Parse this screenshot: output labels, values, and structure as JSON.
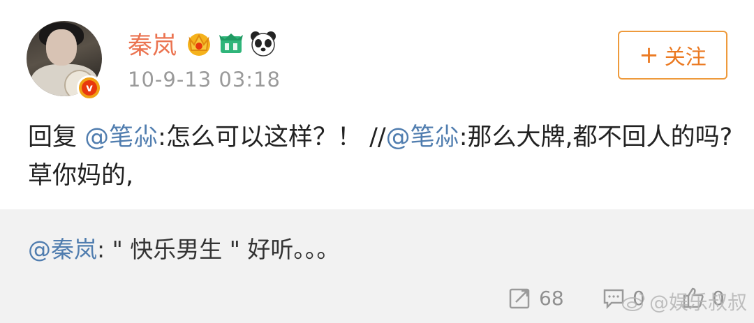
{
  "post": {
    "username": "秦岚",
    "timestamp": "10-9-13 03:18",
    "follow_label": "关注",
    "follow_plus": "+",
    "badges": [
      "crown-badge-icon",
      "green-member-badge-icon",
      "panda-badge-icon"
    ],
    "verified_glyph": "v",
    "content": {
      "prefix": "回复 ",
      "mention1": "@笔尛",
      "text1": ":怎么可以这样？！  //",
      "mention2": "@笔尛",
      "text2": ":那么大牌,都不回人的吗?草你妈的,"
    }
  },
  "repost": {
    "mention": "@秦岚",
    "text": ": \" 快乐男生 \" 好听。。。"
  },
  "actions": {
    "repost_count": "68",
    "comment_count": "0",
    "like_count": "0"
  },
  "watermark": "@娱乐叔叔",
  "colors": {
    "username": "#eb7350",
    "mention": "#507daf",
    "follow": "#eb7a22",
    "repost_bg": "#f2f2f2"
  }
}
